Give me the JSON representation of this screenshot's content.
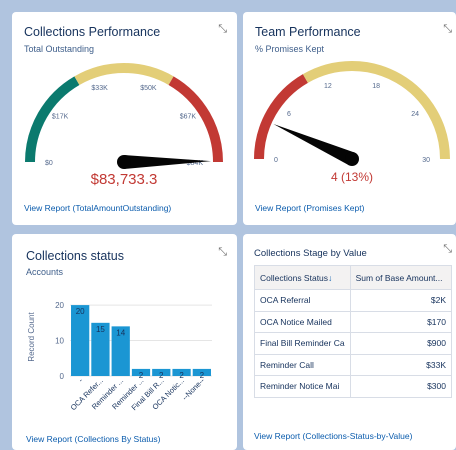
{
  "cards": {
    "collections_performance": {
      "title": "Collections Performance",
      "subtitle": "Total Outstanding",
      "link": "View Report (TotalAmountOutstanding)",
      "gauge": {
        "value": 83733.3,
        "value_label": "$83,733.3",
        "min": 0,
        "max": 84000,
        "ticks": [
          "$0",
          "$17K",
          "$33K",
          "$50K",
          "$67K",
          "$84K"
        ],
        "bands": [
          {
            "from": 0,
            "to": 0.333,
            "color": "#0b7a6e"
          },
          {
            "from": 0.333,
            "to": 0.667,
            "color": "#e3ce78"
          },
          {
            "from": 0.667,
            "to": 1,
            "color": "#c23934"
          }
        ],
        "value_color": "#c23934"
      }
    },
    "team_performance": {
      "title": "Team Performance",
      "subtitle": "% Promises Kept",
      "link": "View Report (Promises Kept)",
      "gauge": {
        "value": 4,
        "value_label": "4 (13%)",
        "min": 0,
        "max": 30,
        "ticks": [
          "0",
          "6",
          "12",
          "18",
          "24",
          "30"
        ],
        "bands": [
          {
            "from": 0,
            "to": 0.333,
            "color": "#c23934"
          },
          {
            "from": 0.333,
            "to": 1,
            "color": "#e3ce78"
          }
        ],
        "value_color": "#c23934"
      }
    },
    "collections_status": {
      "title": "Collections status",
      "subtitle": "Accounts",
      "link": "View Report (Collections By Status)"
    },
    "collections_stage": {
      "title": "Collections Stage by Value",
      "link": "View Report (Collections-Status-by-Value)",
      "table": {
        "headers": [
          "Collections Status",
          "Sum of Base Amount..."
        ],
        "rows": [
          [
            "OCA Referral",
            "$2K"
          ],
          [
            "OCA Notice Mailed",
            "$170"
          ],
          [
            "Final Bill Reminder Ca",
            "$900"
          ],
          [
            "Reminder Call",
            "$33K"
          ],
          [
            "Reminder Notice Mai",
            "$300"
          ]
        ]
      }
    }
  },
  "chart_data": {
    "type": "bar",
    "categories": [
      "-",
      "OCA Refer...",
      "Reminder ...",
      "Reminder ...",
      "Final Bill R...",
      "OCA Notic...",
      "--None--"
    ],
    "values": [
      20,
      15,
      14,
      2,
      2,
      2,
      2
    ],
    "ylabel": "Record Count",
    "yticks": [
      "0",
      "10",
      "20"
    ],
    "ylim": [
      0,
      22
    ],
    "bar_color": "#1b96d3"
  },
  "icons": {
    "expand": "expand-icon"
  }
}
